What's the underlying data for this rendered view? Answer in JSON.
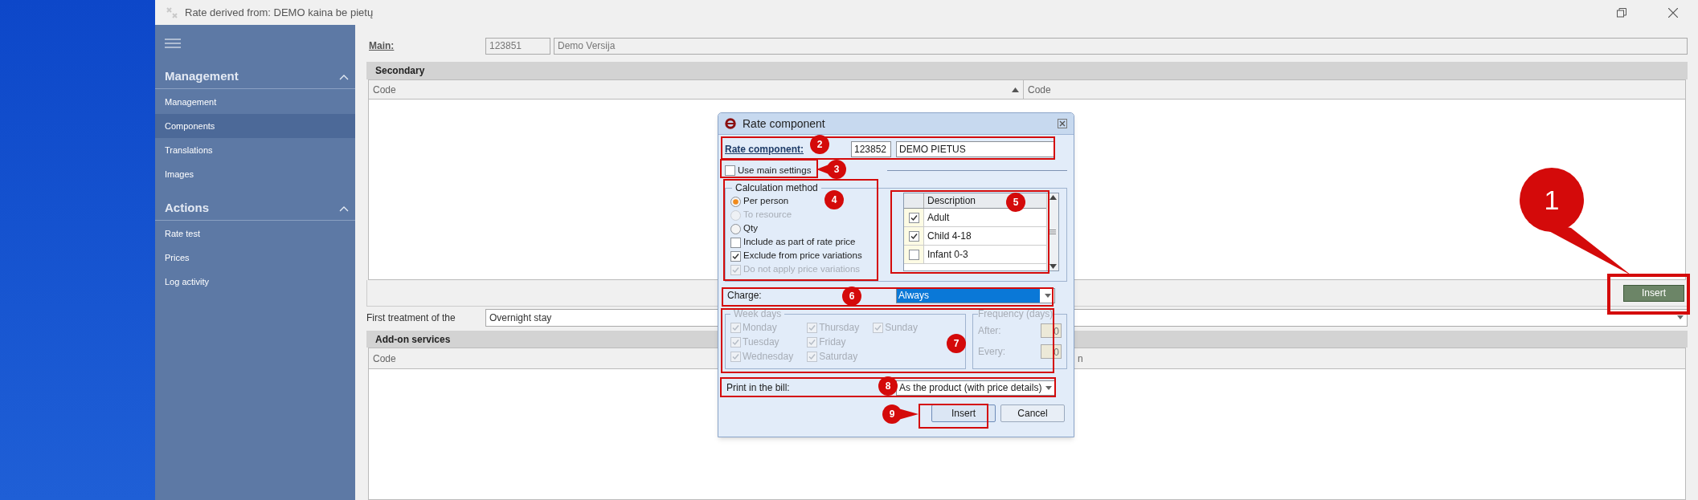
{
  "window": {
    "title": "Rate derived from: DEMO kaina be pietų"
  },
  "sidebar": {
    "sections": [
      {
        "title": "Management",
        "expanded": true,
        "items": [
          {
            "label": "Management",
            "selected": false
          },
          {
            "label": "Components",
            "selected": true
          },
          {
            "label": "Translations",
            "selected": false
          },
          {
            "label": "Images",
            "selected": false
          }
        ]
      },
      {
        "title": "Actions",
        "expanded": true,
        "items": [
          {
            "label": "Rate test",
            "selected": false
          },
          {
            "label": "Prices",
            "selected": false
          },
          {
            "label": "Log activity",
            "selected": false
          }
        ]
      }
    ]
  },
  "main": {
    "label": "Main:",
    "code": "123851",
    "name": "Demo Versija"
  },
  "secondary": {
    "title": "Secondary",
    "columns": [
      {
        "label": "Code",
        "sorted": true
      },
      {
        "label": "Code",
        "sorted": false
      }
    ],
    "button": "Insert"
  },
  "first_treatment": {
    "label": "First treatment of the",
    "value": "Overnight stay"
  },
  "addons": {
    "title": "Add-on services",
    "columns": [
      {
        "label": "Code"
      },
      {
        "label": "n"
      }
    ]
  },
  "dialog": {
    "title": "Rate component",
    "component_label": "Rate component:",
    "code": "123852",
    "name": "DEMO PIETUS",
    "use_main": {
      "label": "Use main settings",
      "checked": false
    },
    "calc": {
      "title": "Calculation method",
      "options": [
        {
          "kind": "radio",
          "label": "Per person",
          "checked": true,
          "disabled": false
        },
        {
          "kind": "radio",
          "label": "To resource",
          "checked": false,
          "disabled": true
        },
        {
          "kind": "radio",
          "label": "Qty",
          "checked": false,
          "disabled": false
        },
        {
          "kind": "checkbox",
          "label": "Include as part of rate price",
          "checked": false,
          "disabled": false
        },
        {
          "kind": "checkbox",
          "label": "Exclude from price variations",
          "checked": true,
          "disabled": false
        },
        {
          "kind": "checkbox",
          "label": "Do not apply price variations",
          "checked": true,
          "disabled": true
        }
      ]
    },
    "guests": {
      "column": "Description",
      "rows": [
        {
          "label": "Adult",
          "checked": true
        },
        {
          "label": "Child 4-18",
          "checked": true
        },
        {
          "label": "Infant 0-3",
          "checked": false
        }
      ]
    },
    "charge": {
      "label": "Charge:",
      "value": "Always"
    },
    "week_days": {
      "title": "Week days",
      "disabled": true,
      "days": [
        {
          "label": "Monday",
          "checked": true
        },
        {
          "label": "Tuesday",
          "checked": true
        },
        {
          "label": "Wednesday",
          "checked": true
        },
        {
          "label": "Thursday",
          "checked": true
        },
        {
          "label": "Friday",
          "checked": true
        },
        {
          "label": "Saturday",
          "checked": true
        },
        {
          "label": "Sunday",
          "checked": true
        }
      ]
    },
    "frequency": {
      "title": "Frequency (days)",
      "after_label": "After:",
      "after": "0",
      "every_label": "Every:",
      "every": "0"
    },
    "print": {
      "label": "Print in the bill:",
      "value": "As the product (with price details)"
    },
    "buttons": [
      {
        "label": "Insert",
        "kind": "primary"
      },
      {
        "label": "Cancel",
        "kind": "default"
      }
    ]
  },
  "annotations": [
    "1",
    "2",
    "3",
    "4",
    "5",
    "6",
    "7",
    "8",
    "9"
  ]
}
